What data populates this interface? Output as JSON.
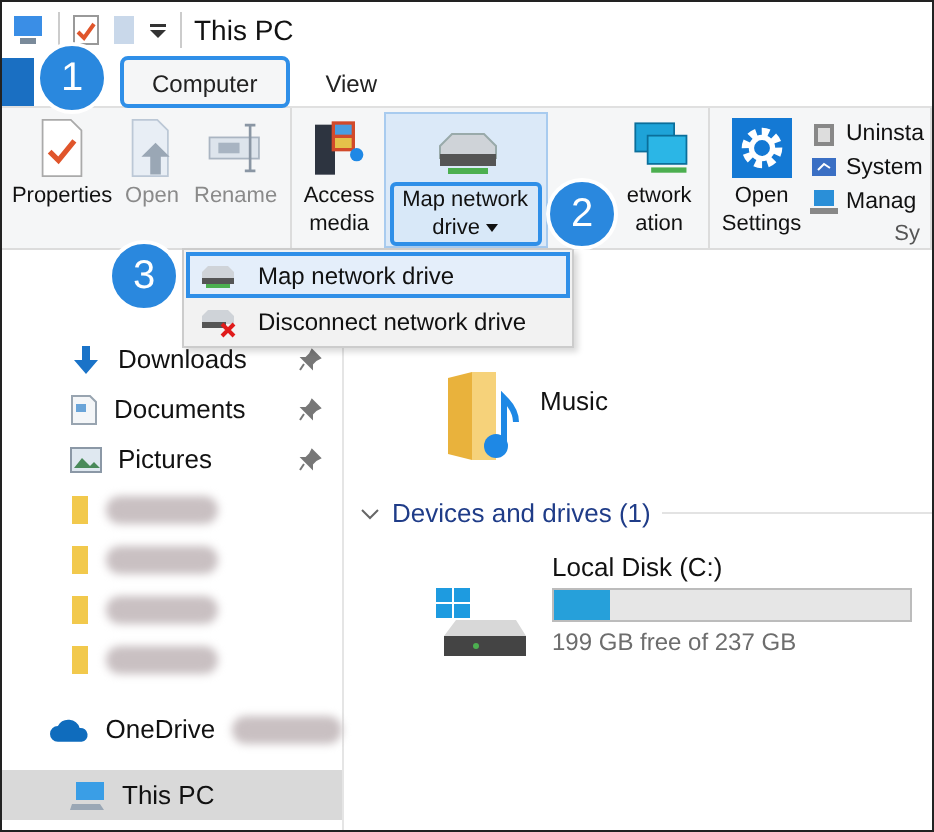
{
  "title_bar": {
    "title": "This PC"
  },
  "tabs": [
    {
      "label": "Computer",
      "selected": true,
      "highlighted": true
    },
    {
      "label": "View",
      "selected": false,
      "highlighted": false
    }
  ],
  "ribbon": {
    "groups": [
      {
        "buttons": [
          {
            "label": "Properties",
            "kind": "properties",
            "disabled": false
          },
          {
            "label": "Open",
            "kind": "open",
            "disabled": true
          },
          {
            "label": "Rename",
            "kind": "rename",
            "disabled": true
          }
        ]
      },
      {
        "buttons": [
          {
            "label": "Access media",
            "kind": "media",
            "disabled": false
          },
          {
            "label": "Map network drive",
            "kind": "mapdrive",
            "disabled": false,
            "dropdown": true,
            "highlighted": true
          },
          {
            "label": "etwork ation",
            "kind": "netlocation",
            "disabled": false
          }
        ]
      },
      {
        "buttons": [
          {
            "label": "Open Settings",
            "kind": "settings",
            "disabled": false
          }
        ],
        "small_items": [
          {
            "label": "Uninsta",
            "kind": "uninstall"
          },
          {
            "label": "System",
            "kind": "system"
          },
          {
            "label": "Manag",
            "kind": "manage"
          }
        ],
        "group_label": "Sy"
      }
    ]
  },
  "menu": {
    "items": [
      {
        "label": "Map network drive",
        "kind": "map",
        "selected": true
      },
      {
        "label": "Disconnect network drive",
        "kind": "disconnect",
        "selected": false
      }
    ]
  },
  "nav": {
    "items": [
      {
        "label": "Downloads",
        "kind": "downloads",
        "pinned": true,
        "selected": false
      },
      {
        "label": "Documents",
        "kind": "documents",
        "pinned": true,
        "selected": false
      },
      {
        "label": "Pictures",
        "kind": "pictures",
        "pinned": true,
        "selected": false
      },
      {
        "kind": "blurred",
        "selected": false
      },
      {
        "kind": "blurred",
        "selected": false
      },
      {
        "kind": "blurred",
        "selected": false
      },
      {
        "kind": "blurred",
        "selected": false
      },
      {
        "label": "OneDrive",
        "kind": "onedrive",
        "selected": false
      },
      {
        "label": "This PC",
        "kind": "thispc",
        "selected": true
      }
    ]
  },
  "content": {
    "folders": [
      {
        "name": "Music"
      }
    ],
    "section": {
      "title": "Devices and drives (1)",
      "expanded": true
    },
    "drives": [
      {
        "name": "Local Disk (C:)",
        "level": 0.16,
        "free": "199 GB free of 237 GB"
      }
    ]
  },
  "callouts": [
    {
      "number": "1"
    },
    {
      "number": "2"
    },
    {
      "number": "3"
    }
  ]
}
